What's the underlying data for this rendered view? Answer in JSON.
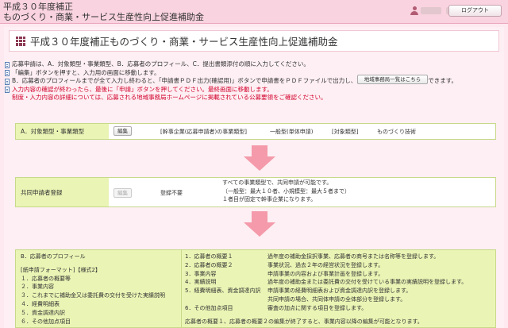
{
  "app": {
    "title_line1": "平成３０年度補正",
    "title_line2": "ものづくり・商業・サービス生産性向上促進補助金",
    "logout_label": "ログアウト"
  },
  "page": {
    "title": "平成３０年度補正ものづくり・商業・サービス生産性向上促進補助金"
  },
  "notes": [
    "応募申請は、A．対象類型・事業類型、B．応募者のプロフィール、C．提出書類添付の順に入力してください。",
    "「編集」ボタンを押すと、入力用の画面に移動します。",
    "B．応募者のプロフィールまでが全て入力し終わると、「申請書ＰＤＦ出力(確認用)」ボタンで申請書をＰＤＦファイルで出力し、内容を申請書の形式で確認できます。",
    "入力内容の確認が終わったら、最後に「申請」ボタンを押してください。最終画面に移動します。",
    "制度・入力内容の詳細については、応募される地域事務局ホームページに掲載されている公募要領をご確認ください。"
  ],
  "region_button_label": "地域事務局一覧はこちら",
  "section_a": {
    "label": "A．対象類型・事業類型",
    "edit_label": "編集",
    "field1_label": "[幹事企業(応募申請者)の事業類型]",
    "field1_value": "一般型(単体申請)",
    "field2_label": "[対象類型]",
    "field2_value": "ものづくり技術"
  },
  "section_joint": {
    "label": "共同申請者登録",
    "edit_label": "編集",
    "status": "登録不要",
    "desc": [
      "すべての事業類型で、共同申請が可能です。",
      "（一般型：最大１０者、小規模型：最大５者まで）",
      "１者目が固定で幹事企業になります。"
    ]
  },
  "section_b": {
    "title": "B．応募者のプロフィール",
    "format_label": "[紙申請フォーマット]【様式2】",
    "left_items": [
      "１．応募者の概要等",
      "２．事業内容",
      "３．これまでに補助金又は委託費の交付を受けた実績説明",
      "４．経費明細表",
      "５．資金調達内訳",
      "６．その他加点項目"
    ],
    "right_items": [
      {
        "name": "1．応募者の概要１",
        "desc": "過年度の補助金採択事業、応募者の商号または名称等を登録します。"
      },
      {
        "name": "2．応募者の概要２",
        "desc": "事業状況、過去２年の経営状況を登録します。"
      },
      {
        "name": "3．事業内容",
        "desc": "申請事業の内容および事業計画を登録します。"
      },
      {
        "name": "4．実績説明",
        "desc": "過年度の補助金または委託費の交付を受けている事業の実績説明を登録します。"
      },
      {
        "name": "5．経費明細表、資金調達内訳",
        "desc": "申請事業の経費明細表および資金調達内訳を登録します。"
      },
      {
        "name": "",
        "desc": "共同申請の場合、共同体申請の全体部分を登録します。"
      },
      {
        "name": "6．その他加点項目",
        "desc": "審査の加点に関する項目を登録します。"
      }
    ],
    "footer": "応募者の概要１、応募者の概要２の編集が終了すると、事業内容以降の編集が可能となります。"
  }
}
